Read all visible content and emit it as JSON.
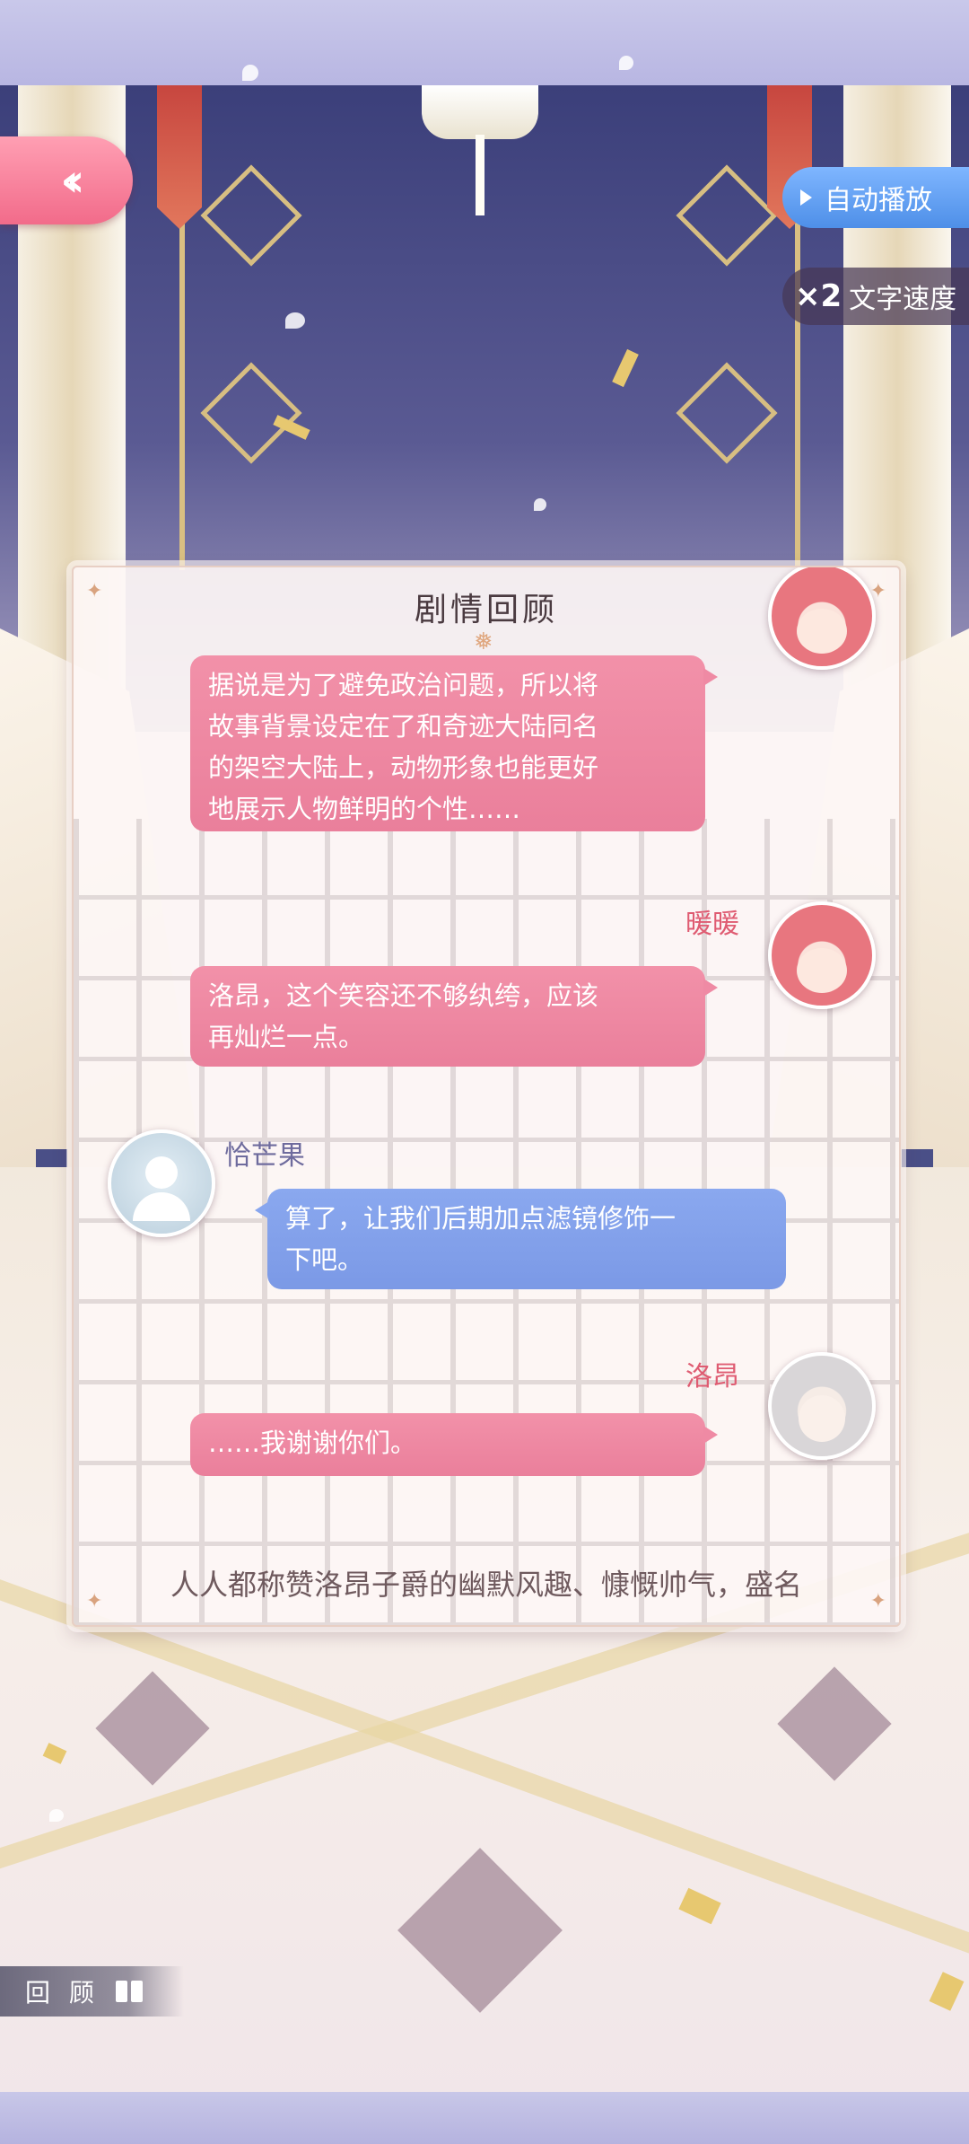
{
  "controls": {
    "back_icon": "double-chevron-left-icon",
    "auto_play_label": "自动播放",
    "speed_multiplier": "×2",
    "speed_label": "文字速度"
  },
  "review_panel": {
    "title": "剧情回顾",
    "messages": [
      {
        "speaker": "",
        "side": "right",
        "color": "pink",
        "text_lines": [
          "据说是为了避免政治问题，所以将",
          "故事背景设定在了和奇迹大陆同名",
          "的架空大陆上，动物形象也能更好",
          "地展示人物鲜明的个性……"
        ]
      },
      {
        "speaker": "暖暖",
        "side": "right",
        "color": "pink",
        "text_lines": [
          "洛昂，这个笑容还不够纨绔，应该",
          "再灿烂一点。"
        ]
      },
      {
        "speaker": "恰芒果",
        "side": "left",
        "color": "blue",
        "text_lines": [
          "算了，让我们后期加点滤镜修饰一",
          "下吧。"
        ]
      },
      {
        "speaker": "洛昂",
        "side": "right",
        "color": "pink",
        "text_lines": [
          "……我谢谢你们。"
        ]
      }
    ],
    "narration": "人人都称赞洛昂子爵的幽默风趣、慷慨帅气，盛名"
  },
  "bottom": {
    "review_label": "回 顾",
    "review_icon": "book-icon"
  }
}
